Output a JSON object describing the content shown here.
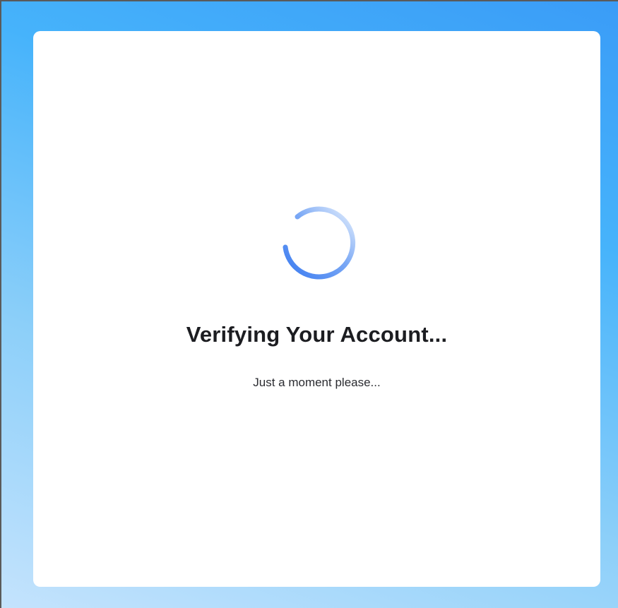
{
  "verification": {
    "title": "Verifying Your Account...",
    "subtitle": "Just a moment please..."
  },
  "spinner": {
    "icon": "loading-spinner-icon",
    "color_start": "#3b7bf0",
    "color_end": "#e6f0fd"
  },
  "colors": {
    "background_top": "#3a9cf7",
    "background_bottom": "#c4e3fd",
    "card": "#ffffff",
    "title_text": "#1c1d21"
  }
}
